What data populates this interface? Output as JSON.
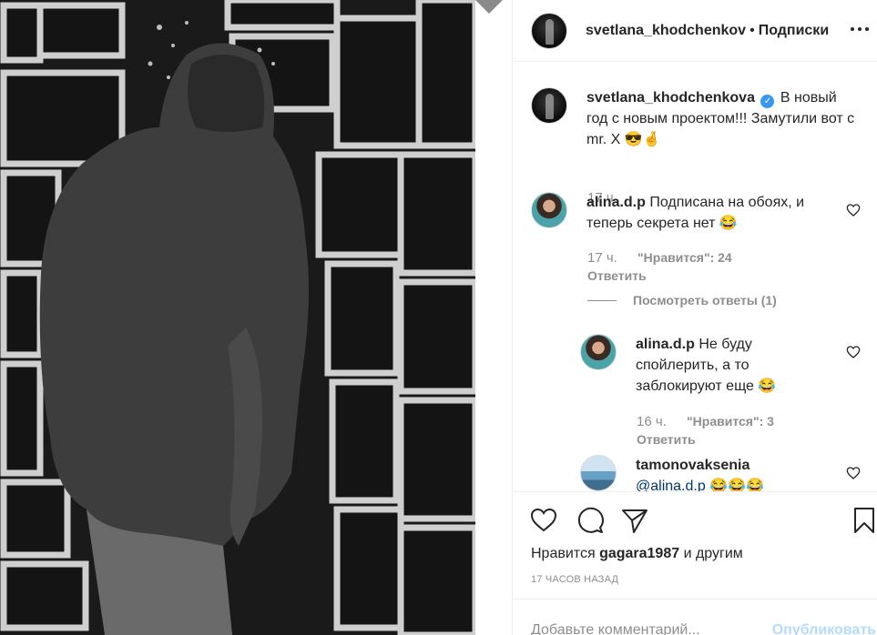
{
  "post": {
    "author": "svetlana_khodchenkov",
    "separator": "•",
    "follow_label": "Подписки",
    "caption": {
      "author": "svetlana_khodchenkova",
      "text": "В новый год с новым проектом!!! Замутили вот с mr. X 😎🤞",
      "time": "17 ч."
    }
  },
  "comments": [
    {
      "author": "alina.d.p",
      "text": "Подписана на обоях, и теперь секрета нет 😂",
      "time": "17 ч.",
      "likes": "\"Нравится\": 24",
      "reply_label": "Ответить",
      "view_replies": "Посмотреть ответы (1)"
    },
    {
      "author": "alina.d.p",
      "text": "Не буду спойлерить, а то заблокируют еще 😂",
      "time": "16 ч.",
      "likes": "\"Нравится\": 3",
      "reply_label": "Ответить"
    },
    {
      "author": "tamonovaksenia",
      "mention": "@alina.d.p",
      "emoji": "😂😂😂"
    }
  ],
  "actions": {
    "likes_prefix": "Нравится",
    "likes_user": "gagara1987",
    "likes_suffix": "и другим",
    "post_time": "17 ЧАСОВ НАЗАД"
  },
  "add_comment": {
    "placeholder": "Добавьте комментарий...",
    "publish_label": "Опубликовать"
  },
  "colors": {
    "text": "#262626",
    "muted": "#8e8e8e",
    "verified": "#3897f0",
    "publish_disabled": "#b3dbff"
  }
}
